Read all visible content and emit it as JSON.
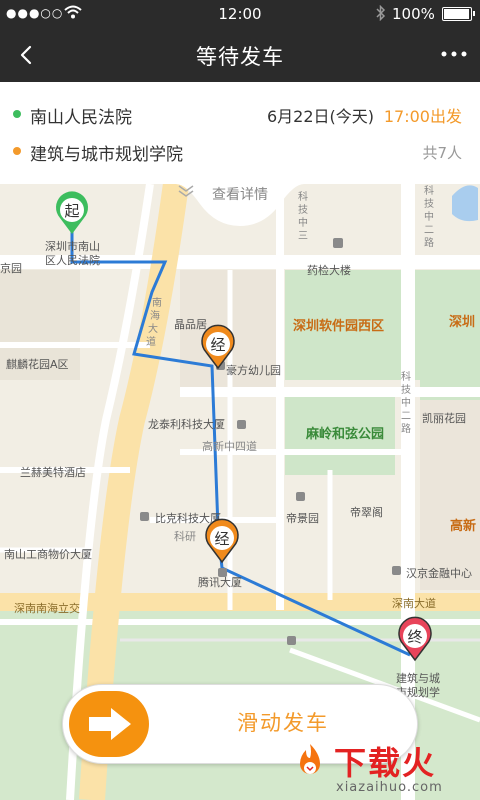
{
  "status": {
    "signal": "●●●○○",
    "time": "12:00",
    "battery": "100%"
  },
  "nav": {
    "title": "等待发车"
  },
  "trip": {
    "start": "南山人民法院",
    "end": "建筑与城市规划学院",
    "date": "6月22日(今天)",
    "departure": "17:00出发",
    "seats": "共7人",
    "start_color": "#3dbd5e",
    "end_color": "#f39a2b"
  },
  "map": {
    "details_label": "查看详情",
    "markers": {
      "start": "起",
      "via1": "经",
      "via2": "经",
      "end": "终"
    },
    "labels": {
      "court": [
        "深圳市南山",
        "区人民法院"
      ],
      "jingyuan": "京园",
      "keji_zhongerlu": [
        "科",
        "技",
        "中",
        "二",
        "路"
      ],
      "keji_road": [
        "科",
        "技",
        "中",
        "三",
        "路"
      ],
      "yaojian": "药检大楼",
      "pinpinju": "晶品居",
      "software_park": "深圳软件园西区",
      "shenzhen_right": "深圳",
      "qilin": "麒麟花园A区",
      "nanhai_avenue": [
        "南",
        "海",
        "大",
        "道"
      ],
      "haofang": "豪方幼儿园",
      "keji_zhong2": [
        "科",
        "技",
        "中",
        "二",
        "路"
      ],
      "kaili": "凯丽花园",
      "longtai": "龙泰利科技大厦",
      "gaoxin_4": "高新中四道",
      "maling": "麻岭和弦公园",
      "lanhe": "兰赫美特酒店",
      "diyuan": "帝景园",
      "dicui": "帝翠阁",
      "gaoxin_right": "高新",
      "bike": "比克科技大厦",
      "keyan": "科研",
      "nanshan_industry": "南山工商物价大厦",
      "tencent": "腾讯大厦",
      "hanjing": "汉京金融中心",
      "shennan_jiao": "深南南海立交",
      "shennan_avenue": "深南大道",
      "architecture": [
        "建筑与城",
        "市规划学",
        "院"
      ]
    }
  },
  "slider": {
    "label": "滑动发车"
  },
  "watermark": {
    "text": "下载火",
    "sub": "xiazaihuo.com"
  }
}
